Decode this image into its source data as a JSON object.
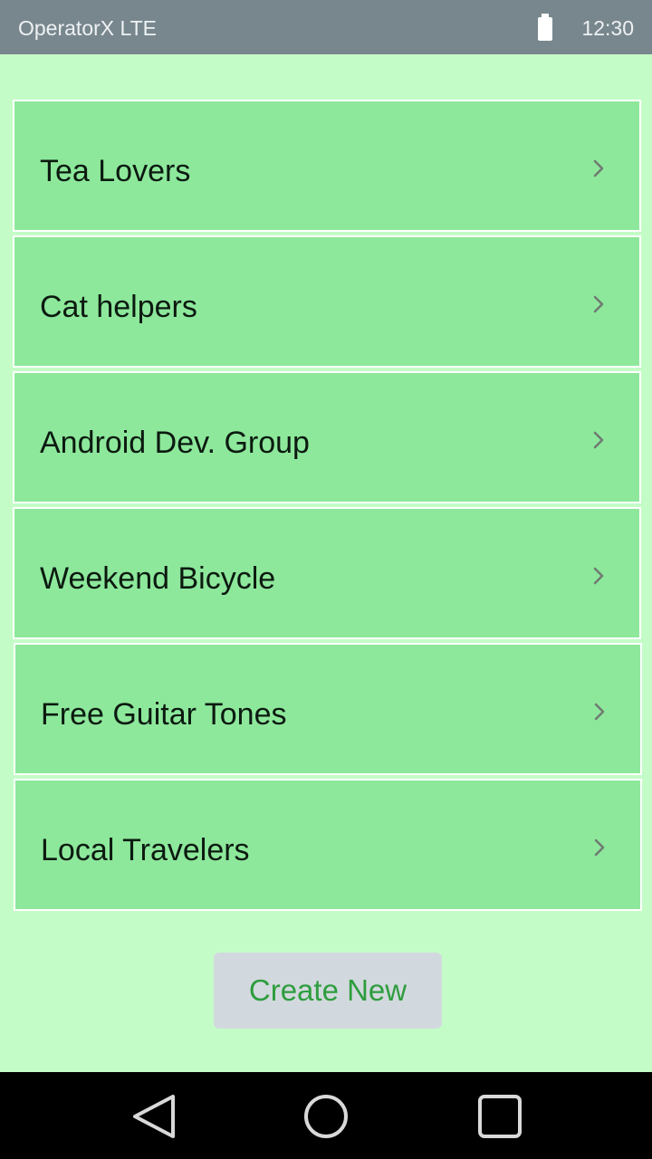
{
  "status_bar": {
    "carrier": "OperatorX LTE",
    "time": "12:30",
    "battery_icon": "battery-full-icon"
  },
  "groups": [
    {
      "name": "Tea Lovers"
    },
    {
      "name": "Cat helpers"
    },
    {
      "name": "Android Dev. Group"
    },
    {
      "name": "Weekend Bicycle"
    },
    {
      "name": "Free Guitar Tones"
    },
    {
      "name": "Local Travelers"
    }
  ],
  "actions": {
    "create_label": "Create New"
  },
  "nav_bar": {
    "back_icon": "back-triangle-icon",
    "home_icon": "home-circle-icon",
    "recents_icon": "recents-square-icon"
  },
  "colors": {
    "background": "#c4fcc8",
    "row": "#8de89b",
    "status_bar": "#78878e",
    "button": "#d2d9de",
    "button_text": "#2e9d3e"
  }
}
